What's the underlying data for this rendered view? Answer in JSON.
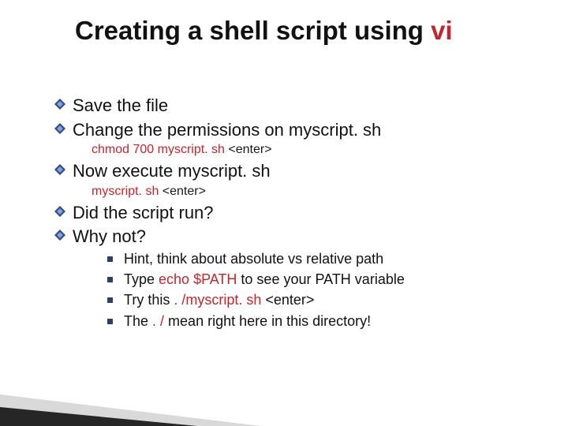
{
  "title_plain": "Creating a shell script using ",
  "title_accent": "vi",
  "items": {
    "b1": "Save the file",
    "b2": "Change the permissions on myscript. sh",
    "b2_sub_cmd": "chmod 700 myscript. sh ",
    "b2_sub_tail": " <enter>",
    "b3": "Now execute myscript. sh",
    "b3_sub_cmd": "myscript. sh",
    "b3_sub_tail": " <enter>",
    "b4": "Did the script run?",
    "b5": "Why not?"
  },
  "hints": {
    "h1": "Hint, think about absolute vs relative path",
    "h2_a": "Type ",
    "h2_b": "echo $PATH",
    "h2_c": " to see your PATH variable",
    "h3_a": "Try this ",
    "h3_b": " . /myscript. sh",
    "h3_c": " <enter>",
    "h4_a": "The",
    "h4_b": " . / ",
    "h4_c": "mean right here in this directory!"
  }
}
